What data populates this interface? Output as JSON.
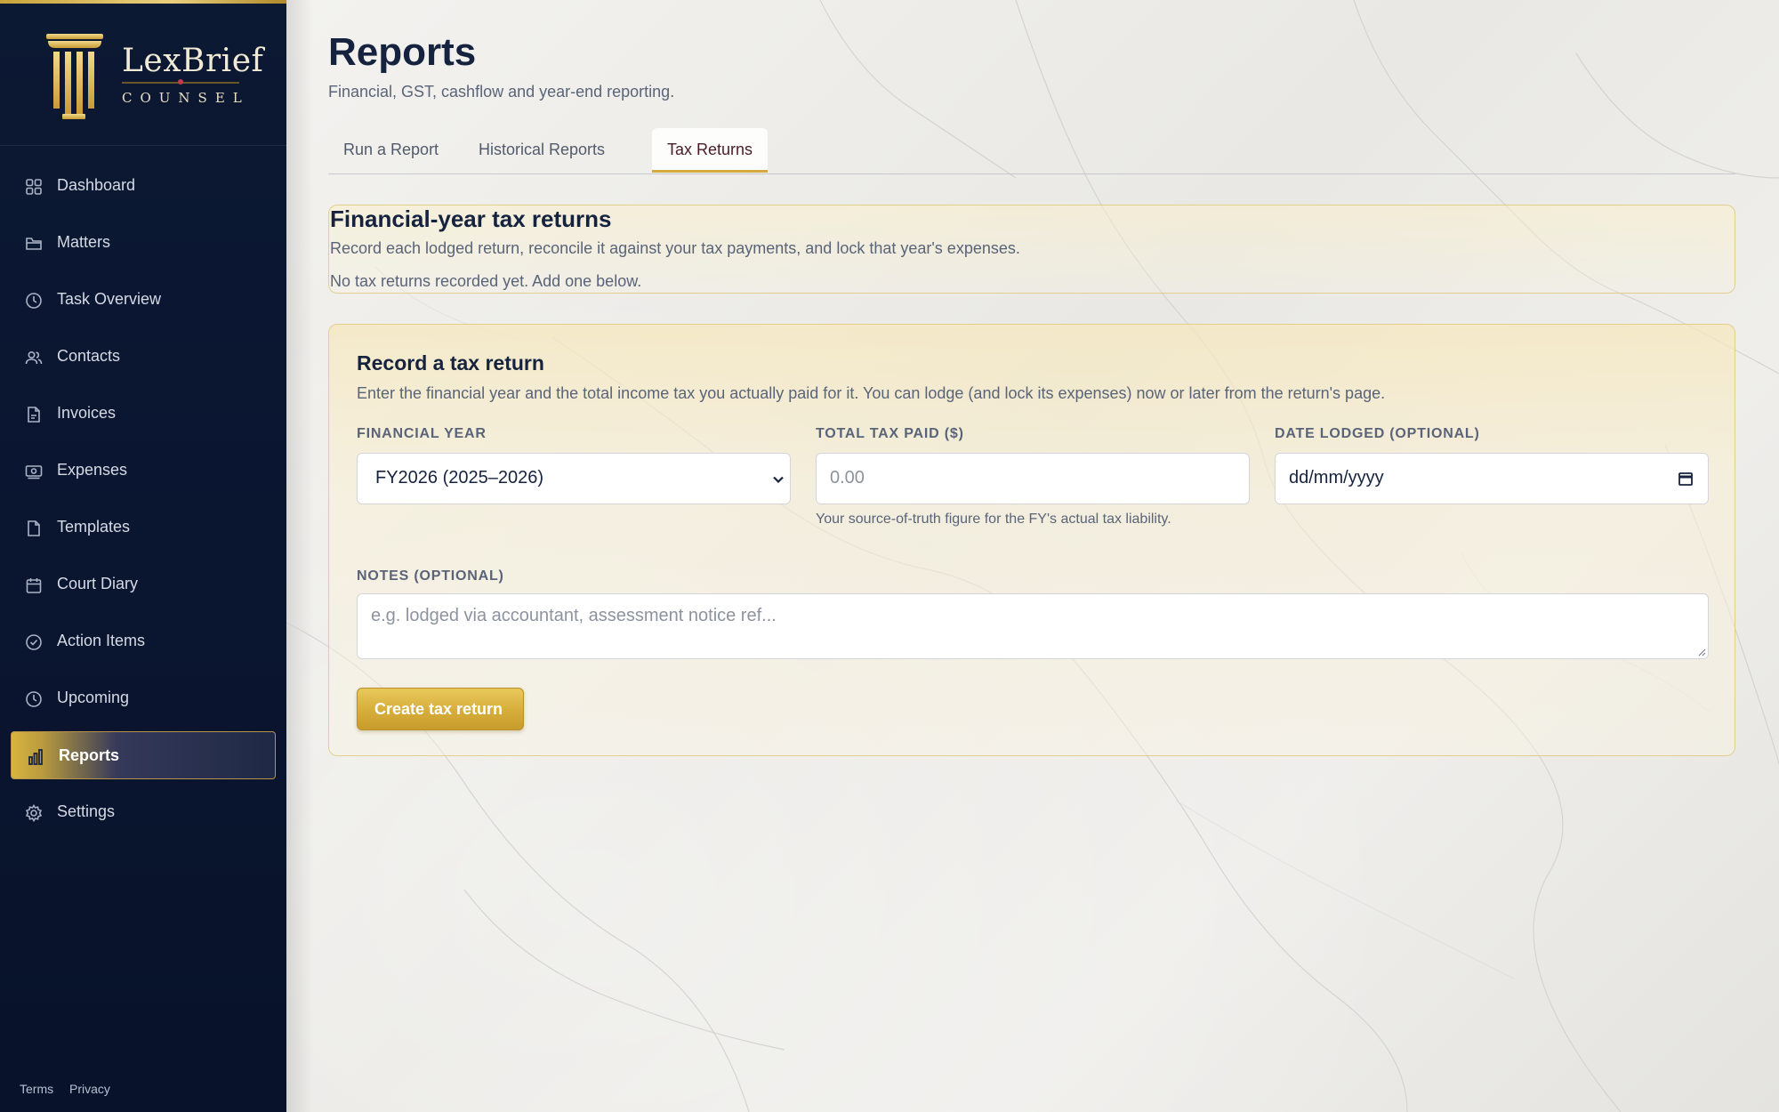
{
  "brand": {
    "name": "LexBrief",
    "sub": "COUNSEL"
  },
  "sidebar": {
    "items": [
      {
        "label": "Dashboard",
        "icon": "grid-icon"
      },
      {
        "label": "Matters",
        "icon": "folder-icon"
      },
      {
        "label": "Task Overview",
        "icon": "clock-icon"
      },
      {
        "label": "Contacts",
        "icon": "users-icon"
      },
      {
        "label": "Invoices",
        "icon": "invoice-icon"
      },
      {
        "label": "Expenses",
        "icon": "cash-icon"
      },
      {
        "label": "Templates",
        "icon": "document-icon"
      },
      {
        "label": "Court Diary",
        "icon": "calendar-icon"
      },
      {
        "label": "Action Items",
        "icon": "check-circle-icon"
      },
      {
        "label": "Upcoming",
        "icon": "clock-icon"
      },
      {
        "label": "Reports",
        "icon": "bar-chart-icon",
        "active": true
      },
      {
        "label": "Settings",
        "icon": "gear-icon"
      }
    ],
    "footer": {
      "terms": "Terms",
      "privacy": "Privacy"
    }
  },
  "header": {
    "title": "Reports",
    "subtitle": "Financial, GST, cashflow and year-end reporting."
  },
  "tabs": [
    {
      "label": "Run a Report"
    },
    {
      "label": "Historical Reports"
    },
    {
      "label": "Tax Returns",
      "active": true
    }
  ],
  "returns_card": {
    "title": "Financial-year tax returns",
    "description": "Record each lodged return, reconcile it against your tax payments, and lock that year's expenses.",
    "empty": "No tax returns recorded yet. Add one below."
  },
  "form": {
    "title": "Record a tax return",
    "description": "Enter the financial year and the total income tax you actually paid for it. You can lodge (and lock its expenses) now or later from the return's page.",
    "financial_year": {
      "label": "FINANCIAL YEAR",
      "value": "FY2026 (2025–2026)"
    },
    "total_tax": {
      "label": "TOTAL TAX PAID ($)",
      "placeholder": "0.00",
      "hint": "Your source-of-truth figure for the FY's actual tax liability."
    },
    "date_lodged": {
      "label": "DATE LODGED (OPTIONAL)",
      "placeholder": "dd/mm/yyyy"
    },
    "notes": {
      "label": "NOTES (OPTIONAL)",
      "placeholder": "e.g. lodged via accountant, assessment notice ref..."
    },
    "submit": "Create tax return"
  },
  "colors": {
    "sidebar": "#0c1933",
    "accent_gold": "#d6ad3b",
    "tab_active_text": "#4a1c2a",
    "heading": "#16233f"
  }
}
